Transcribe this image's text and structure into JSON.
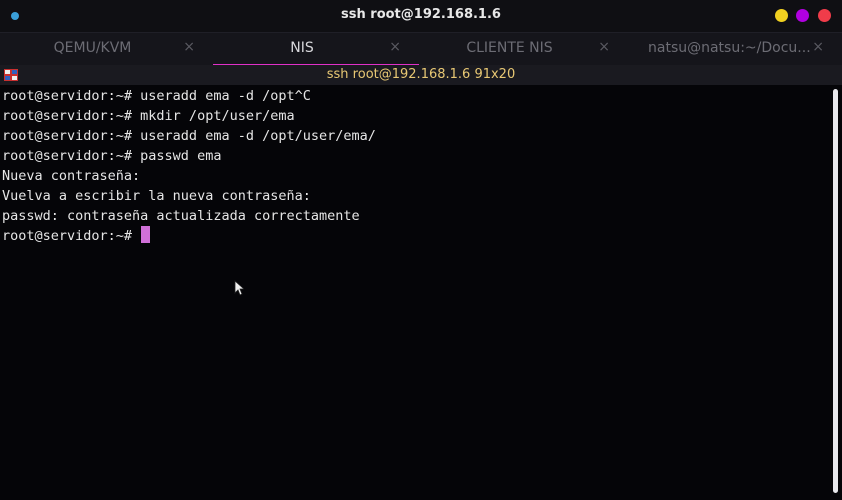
{
  "window": {
    "title": "ssh root@192.168.1.6"
  },
  "tabs": [
    {
      "label": "QEMU/KVM",
      "close": "×",
      "active": false
    },
    {
      "label": "NIS",
      "close": "×",
      "active": true
    },
    {
      "label": "CLIENTE NIS",
      "close": "×",
      "active": false
    },
    {
      "label": "natsu@natsu:~/Docu...",
      "close": "×",
      "active": false
    }
  ],
  "terminal": {
    "header_title": "ssh root@192.168.1.6 91x20",
    "lines": [
      "root@servidor:~# useradd ema -d /opt^C",
      "root@servidor:~# mkdir /opt/user/ema",
      "root@servidor:~# useradd ema -d /opt/user/ema/",
      "root@servidor:~# passwd ema",
      "Nueva contraseña:",
      "Vuelva a escribir la nueva contraseña:",
      "passwd: contraseña actualizada correctamente"
    ],
    "prompt": "root@servidor:~# "
  },
  "colors": {
    "accent_tab_underline": "#e030c8",
    "cursor": "#d070d8",
    "header_title": "#e8c874",
    "min_button": "#f0d020",
    "max_button": "#b000e0",
    "close_button": "#f03c4a"
  },
  "icons": {
    "window_menu": "dot-icon",
    "terminal": "terminal-icon",
    "pointer": "mouse-pointer-icon"
  }
}
